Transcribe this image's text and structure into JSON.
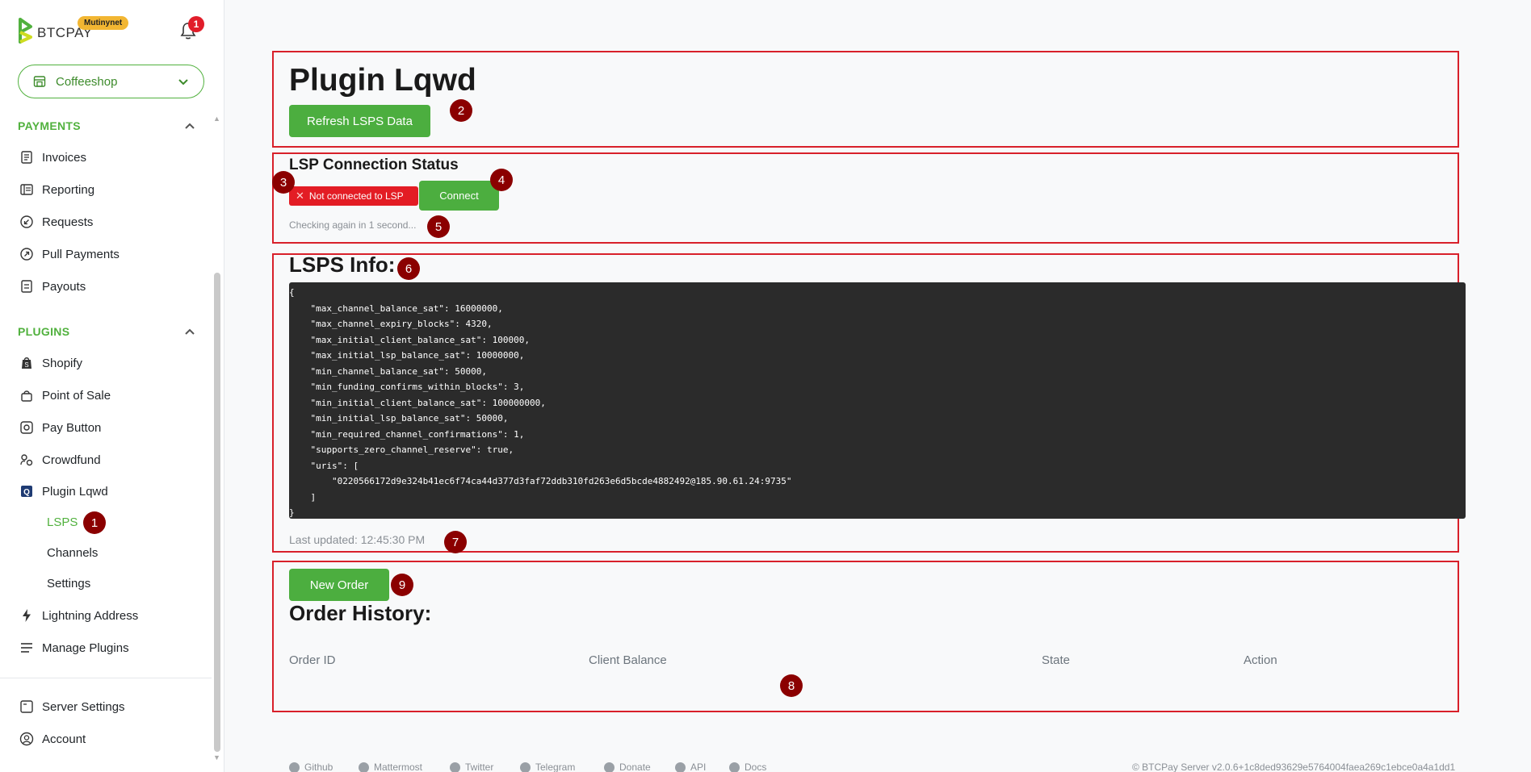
{
  "header": {
    "brand": "BTCPAY",
    "network_badge": "Mutinynet",
    "notification_count": "1",
    "store_name": "Coffeeshop"
  },
  "sidebar": {
    "payments_heading": "PAYMENTS",
    "payments": [
      {
        "label": "Invoices",
        "icon": "invoice-icon"
      },
      {
        "label": "Reporting",
        "icon": "reporting-icon"
      },
      {
        "label": "Requests",
        "icon": "requests-icon"
      },
      {
        "label": "Pull Payments",
        "icon": "pull-payments-icon"
      },
      {
        "label": "Payouts",
        "icon": "payouts-icon"
      }
    ],
    "plugins_heading": "PLUGINS",
    "plugins": [
      {
        "label": "Shopify",
        "icon": "shopify-icon"
      },
      {
        "label": "Point of Sale",
        "icon": "pos-icon"
      },
      {
        "label": "Pay Button",
        "icon": "pay-button-icon"
      },
      {
        "label": "Crowdfund",
        "icon": "crowdfund-icon"
      },
      {
        "label": "Plugin Lqwd",
        "icon": "lqwd-icon"
      }
    ],
    "plugin_sub": [
      "LSPS",
      "Channels",
      "Settings"
    ],
    "more": [
      {
        "label": "Lightning Address",
        "icon": "lightning-icon"
      },
      {
        "label": "Manage Plugins",
        "icon": "manage-plugins-icon"
      }
    ],
    "bottom": [
      {
        "label": "Server Settings",
        "icon": "server-icon"
      },
      {
        "label": "Account",
        "icon": "account-icon"
      }
    ]
  },
  "main": {
    "title": "Plugin Lqwd",
    "refresh_button": "Refresh LSPS Data",
    "lsp_heading": "LSP Connection Status",
    "not_connected": "Not connected to LSP",
    "connect_button": "Connect",
    "status_note": "Checking again in 1 second...",
    "info_heading": "LSPS Info:",
    "lsps_json": "{\n    \"max_channel_balance_sat\": 16000000,\n    \"max_channel_expiry_blocks\": 4320,\n    \"max_initial_client_balance_sat\": 100000,\n    \"max_initial_lsp_balance_sat\": 10000000,\n    \"min_channel_balance_sat\": 50000,\n    \"min_funding_confirms_within_blocks\": 3,\n    \"min_initial_client_balance_sat\": 100000000,\n    \"min_initial_lsp_balance_sat\": 50000,\n    \"min_required_channel_confirmations\": 1,\n    \"supports_zero_channel_reserve\": true,\n    \"uris\": [\n        \"0220566172d9e324b41ec6f74ca44d377d3faf72ddb310fd263e6d5bcde4882492@185.90.61.24:9735\"\n    ]\n}",
    "last_updated": "Last updated: 12:45:30 PM",
    "new_order_button": "New Order",
    "orders_heading": "Order History:",
    "columns": [
      "Order ID",
      "Client Balance",
      "State",
      "Action"
    ]
  },
  "footer": {
    "links": [
      "Github",
      "Mattermost",
      "Twitter",
      "Telegram",
      "Donate",
      "API",
      "Docs"
    ],
    "version": "© BTCPay Server v2.0.6+1c8ded93629e5764004faea269c1ebce0a4a1dd1"
  },
  "annotations": [
    "1",
    "2",
    "3",
    "4",
    "5",
    "6",
    "7",
    "8",
    "9"
  ],
  "colors": {
    "brand_green": "#51b13e",
    "button_green": "#4cae3f",
    "error_red": "#e31c24",
    "annotation_box": "#d8202a",
    "annotation_marker": "#8b0000"
  }
}
